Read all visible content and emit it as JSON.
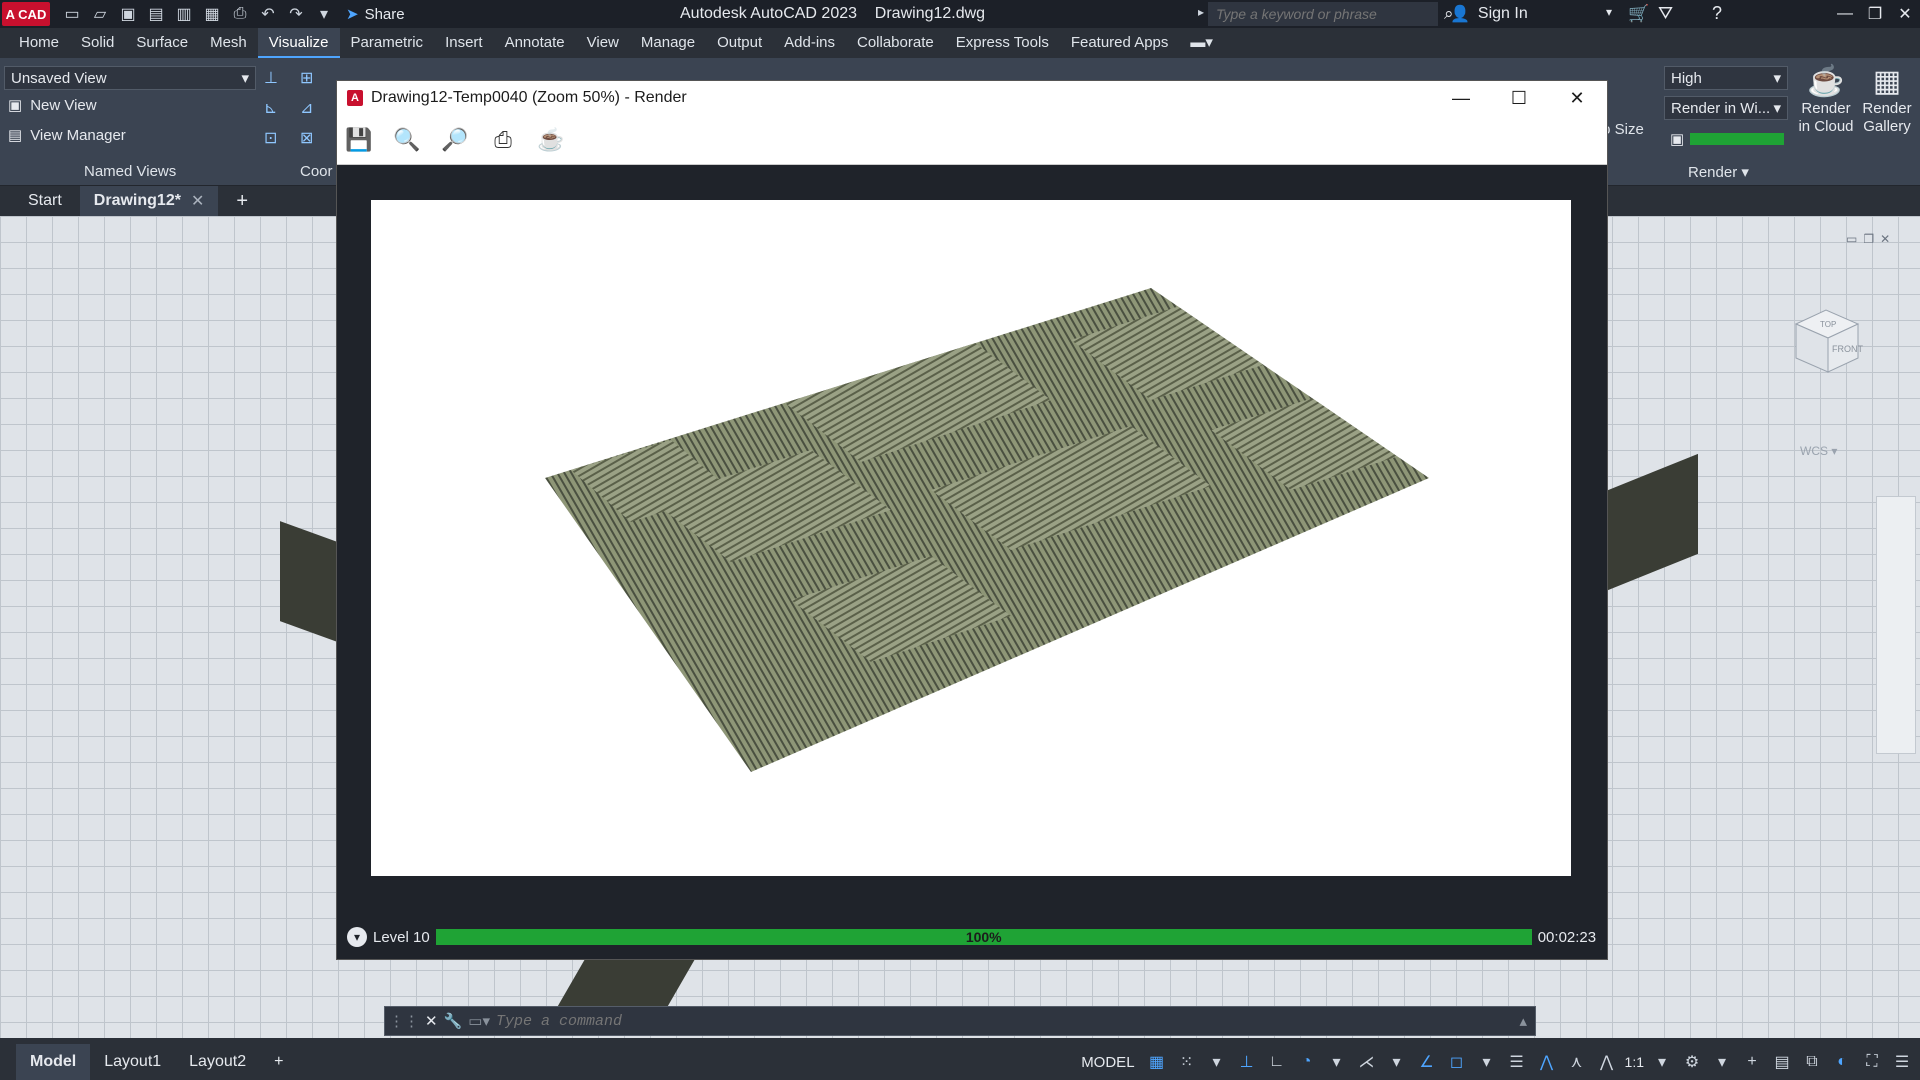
{
  "app": {
    "logo_text": "A CAD",
    "title": "Autodesk AutoCAD 2023",
    "document": "Drawing12.dwg",
    "share_label": "Share",
    "search_placeholder": "Type a keyword or phrase",
    "signin_label": "Sign In"
  },
  "ribbon_tabs": [
    "Home",
    "Solid",
    "Surface",
    "Mesh",
    "Visualize",
    "Parametric",
    "Insert",
    "Annotate",
    "View",
    "Manage",
    "Output",
    "Add-ins",
    "Collaborate",
    "Express Tools",
    "Featured Apps"
  ],
  "active_tab": "Visualize",
  "ribbon": {
    "view_dropdown": "Unsaved View",
    "new_view": "New View",
    "view_manager": "View Manager",
    "named_views_title": "Named Views",
    "coords_title": "Coor",
    "render_quality": "High",
    "render_in": "Render in Wi...",
    "render_to_size": "to Size",
    "render_in_cloud": "Render in Cloud",
    "render_gallery": "Render Gallery",
    "render_panel_title": "Render"
  },
  "doc_tabs": {
    "start": "Start",
    "active": "Drawing12*"
  },
  "render_window": {
    "title": "Drawing12-Temp0040 (Zoom 50%) - Render",
    "level": "Level 10",
    "progress_label": "100%",
    "progress_value": 1.0,
    "elapsed": "00:02:23",
    "toolbar": [
      "save-icon",
      "zoom-in-icon",
      "zoom-out-icon",
      "print-icon",
      "teapot-icon"
    ]
  },
  "viewcube": {
    "top": "TOP",
    "front": "FRONT",
    "wcs": "WCS"
  },
  "command_line": {
    "placeholder": "Type a command"
  },
  "layout_tabs": [
    "Model",
    "Layout1",
    "Layout2"
  ],
  "status": {
    "model_label": "MODEL",
    "scale": "1:1"
  },
  "colors": {
    "accent": "#4ea5ff",
    "progress": "#1fa335",
    "brand": "#c8102e"
  }
}
